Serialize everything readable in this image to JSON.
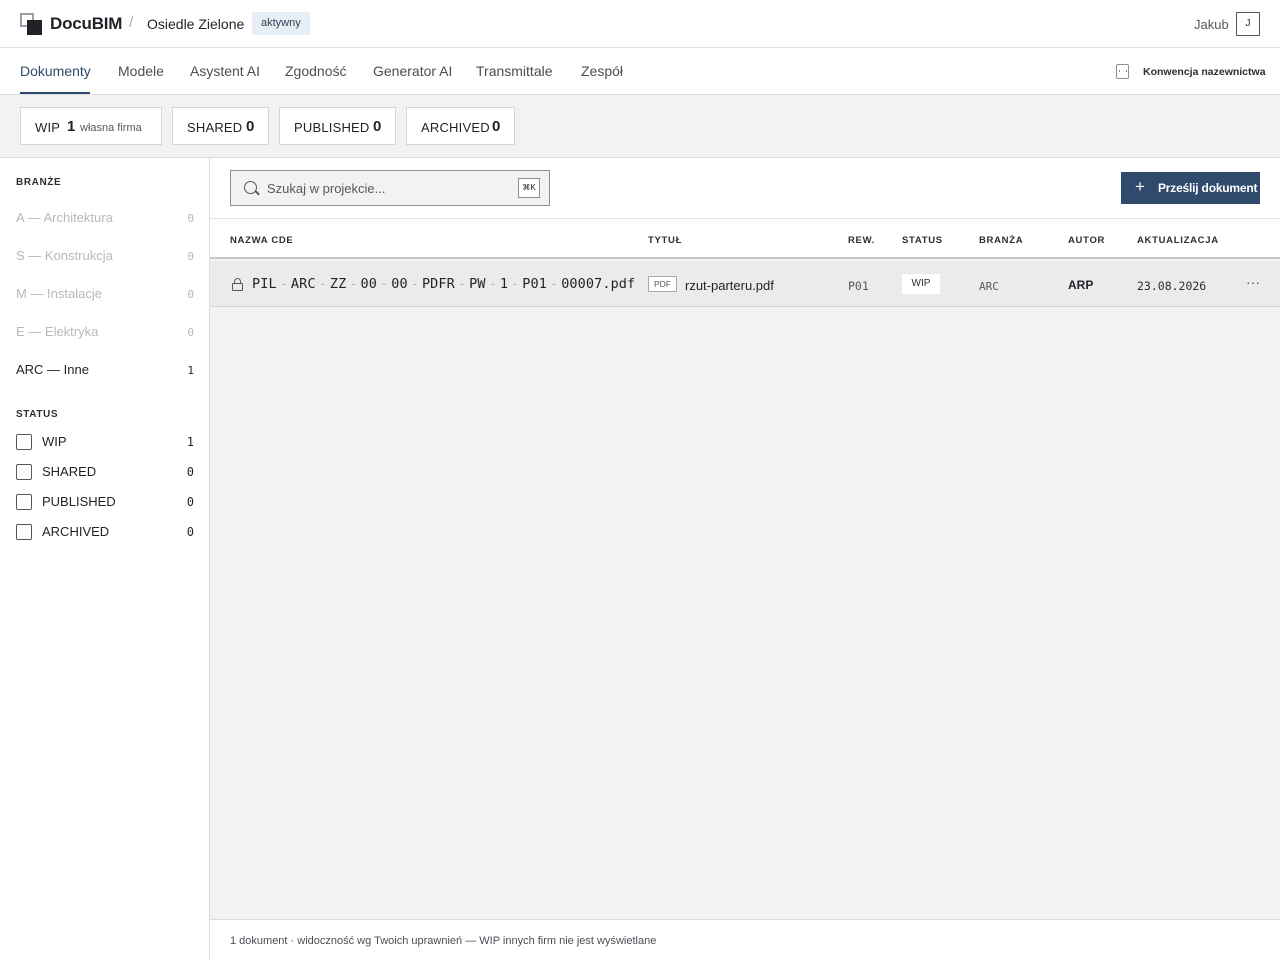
{
  "app": {
    "name": "DocuBIM",
    "separator": "/",
    "project": "Osiedle Zielone",
    "project_badge": "aktywny"
  },
  "user": {
    "name": "Jakub",
    "initial": "J"
  },
  "nav": {
    "tabs": [
      {
        "label": "Dokumenty",
        "active": true
      },
      {
        "label": "Modele"
      },
      {
        "label": "Asystent AI"
      },
      {
        "label": "Zgodność"
      },
      {
        "label": "Generator AI"
      },
      {
        "label": "Transmittale"
      },
      {
        "label": "Zespół"
      }
    ],
    "convention_link": "Konwencja nazewnictwa"
  },
  "status_cards": [
    {
      "label": "WIP",
      "count": "1",
      "note": "własna firma"
    },
    {
      "label": "SHARED",
      "count": "0"
    },
    {
      "label": "PUBLISHED",
      "count": "0"
    },
    {
      "label": "ARCHIVED",
      "count": "0"
    }
  ],
  "sidebar": {
    "branches_title": "BRANŻE",
    "branches": [
      {
        "label": "A — Architektura",
        "count": "0"
      },
      {
        "label": "S — Konstrukcja",
        "count": "0"
      },
      {
        "label": "M — Instalacje",
        "count": "0"
      },
      {
        "label": "E — Elektryka",
        "count": "0"
      },
      {
        "label": "ARC — Inne",
        "count": "1",
        "active": true
      }
    ],
    "status_title": "STATUS",
    "statuses": [
      {
        "label": "WIP",
        "count": "1",
        "checked": false
      },
      {
        "label": "SHARED",
        "count": "0",
        "checked": false
      },
      {
        "label": "PUBLISHED",
        "count": "0",
        "checked": false
      },
      {
        "label": "ARCHIVED",
        "count": "0",
        "checked": false
      }
    ]
  },
  "toolbar": {
    "search_placeholder": "Szukaj w projekcie...",
    "search_value": "",
    "shortcut": "⌘K",
    "upload_label": "Prześlij dokument"
  },
  "table": {
    "columns": [
      "NAZWA CDE",
      "TYTUŁ",
      "REW.",
      "STATUS",
      "BRANŻA",
      "AUTOR",
      "AKTUALIZACJA"
    ],
    "rows": [
      {
        "cde_parts": [
          "PIL",
          "ARC",
          "ZZ",
          "00",
          "00",
          "PDFR",
          "PW",
          "1",
          "P01",
          "00007.pdf"
        ],
        "file_type": "PDF",
        "title": "rzut-parteru.pdf",
        "revision": "P01",
        "status": "WIP",
        "branch": "ARC",
        "author": "ARP",
        "updated": "23.08.2026",
        "locked": true
      }
    ]
  },
  "footer": {
    "text": "1 dokument · widoczność wg Twoich uprawnień — WIP innych firm nie jest wyświetlane"
  },
  "colors": {
    "accent": "#2f4a6d",
    "badge_bg": "#e8eef6",
    "panel_bg": "#f2f2f2",
    "row_bg": "#ebebeb"
  }
}
